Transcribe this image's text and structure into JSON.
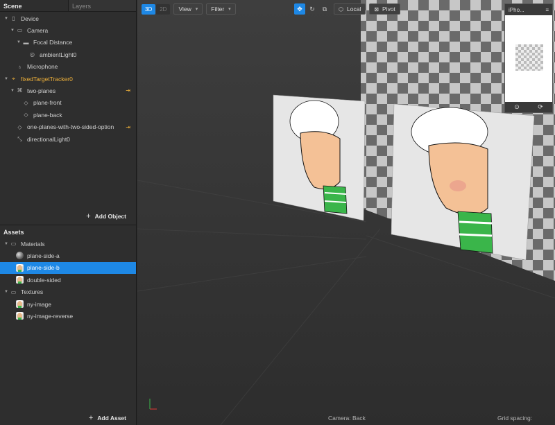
{
  "tabs": {
    "scene": "Scene",
    "layers": "Layers"
  },
  "scene_tree": [
    {
      "label": "Device",
      "icon": "device-icon",
      "indent": 0,
      "caret": "open"
    },
    {
      "label": "Camera",
      "icon": "camera-icon",
      "indent": 1,
      "caret": "open"
    },
    {
      "label": "Focal Distance",
      "icon": "focal-distance-icon",
      "indent": 2,
      "caret": "open"
    },
    {
      "label": "ambientLight0",
      "icon": "ambient-light-icon",
      "indent": 3,
      "caret": ""
    },
    {
      "label": "Microphone",
      "icon": "microphone-icon",
      "indent": 1,
      "caret": ""
    },
    {
      "label": "fixedTargetTracker0",
      "icon": "target-tracker-icon",
      "indent": 0,
      "caret": "open",
      "highlight": true
    },
    {
      "label": "two-planes",
      "icon": "null-object-icon",
      "indent": 1,
      "caret": "open",
      "action": true
    },
    {
      "label": "plane-front",
      "icon": "plane-icon",
      "indent": 2,
      "caret": ""
    },
    {
      "label": "plane-back",
      "icon": "plane-icon",
      "indent": 2,
      "caret": ""
    },
    {
      "label": "one-planes-with-two-sided-option",
      "icon": "plane-icon",
      "indent": 1,
      "caret": "",
      "action": true
    },
    {
      "label": "directionalLight0",
      "icon": "directional-light-icon",
      "indent": 1,
      "caret": ""
    }
  ],
  "add_object": "Add Object",
  "assets_title": "Assets",
  "assets_tree": [
    {
      "label": "Materials",
      "icon": "folder-icon",
      "indent": 0,
      "caret": "open"
    },
    {
      "label": "plane-side-a",
      "icon": "material-sphere-icon",
      "indent": 1,
      "caret": ""
    },
    {
      "label": "plane-side-b",
      "icon": "material-image-icon",
      "indent": 1,
      "caret": "",
      "selected": true
    },
    {
      "label": "double-sided",
      "icon": "material-image-icon",
      "indent": 1,
      "caret": ""
    },
    {
      "label": "Textures",
      "icon": "folder-icon",
      "indent": 0,
      "caret": "open"
    },
    {
      "label": "ny-image",
      "icon": "texture-image-icon",
      "indent": 1,
      "caret": ""
    },
    {
      "label": "ny-image-reverse",
      "icon": "texture-image-icon",
      "indent": 1,
      "caret": ""
    }
  ],
  "add_asset": "Add Asset",
  "viewport": {
    "mode_3d": "3D",
    "mode_2d": "2D",
    "view_label": "View",
    "filter_label": "Filter",
    "local_label": "Local",
    "pivot_label": "Pivot",
    "device_label": "iPho...",
    "camera_status": "Camera: Back",
    "grid_spacing": "Grid spacing:"
  },
  "colors": {
    "accent": "#1e88e5",
    "highlight": "#f2b33a"
  }
}
